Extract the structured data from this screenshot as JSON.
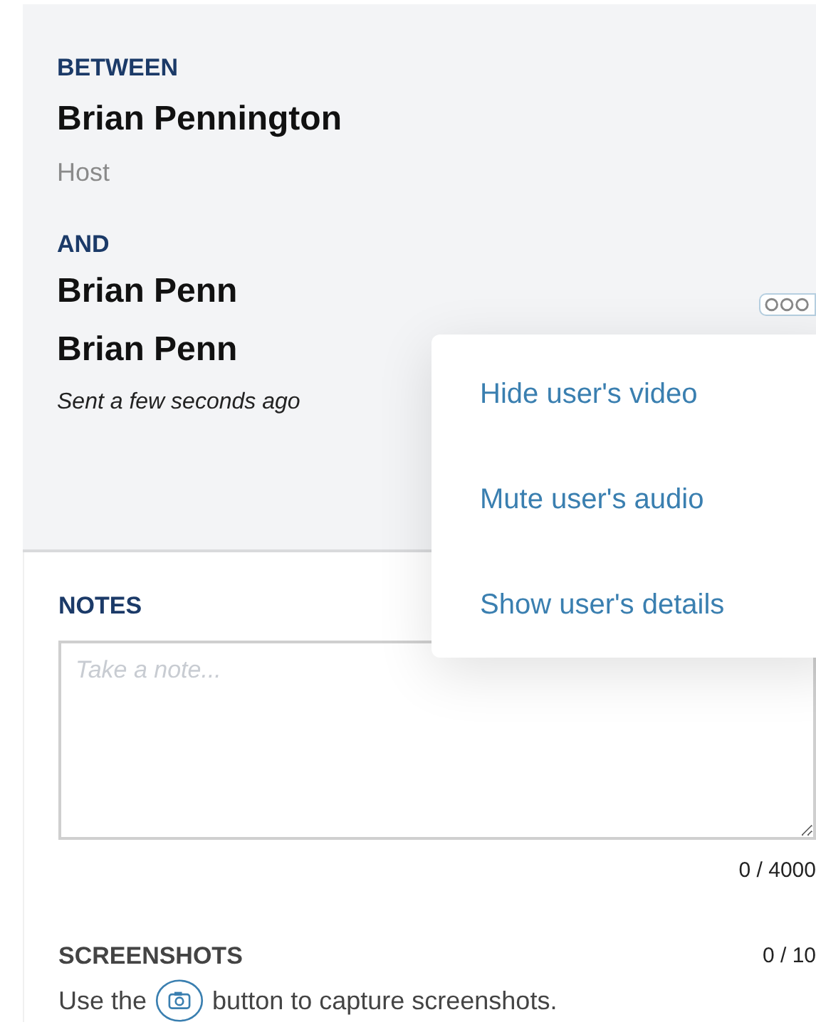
{
  "participants": {
    "between_label": "BETWEEN",
    "first": {
      "name": "Brian Pennington",
      "role": "Host"
    },
    "and_label": "AND",
    "second": {
      "names": [
        "Brian Penn",
        "Brian Penn"
      ],
      "sent": "Sent a few seconds ago"
    }
  },
  "menu": {
    "items": [
      {
        "label": "Hide user's video"
      },
      {
        "label": "Mute user's audio"
      },
      {
        "label": "Show user's details"
      }
    ]
  },
  "notes": {
    "title": "NOTES",
    "placeholder": "Take a note...",
    "counter": "0 / 4000"
  },
  "screenshots": {
    "title": "SCREENSHOTS",
    "counter": "0 / 10",
    "hint_before": "Use the",
    "hint_after": "button to capture screenshots."
  }
}
